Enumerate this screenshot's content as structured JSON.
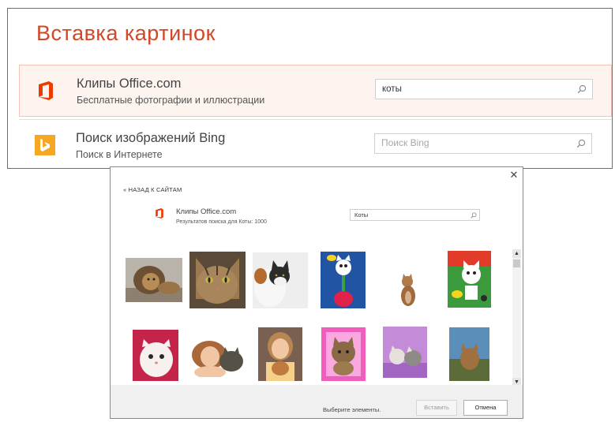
{
  "top_dialog": {
    "title": "Вставка картинок",
    "sources": [
      {
        "name": "Клипы Office.com",
        "description": "Бесплатные фотографии и иллюстрации",
        "search_value": "коты",
        "search_placeholder": "",
        "icon": "office-icon",
        "selected": true
      },
      {
        "name": "Поиск изображений Bing",
        "description": "Поиск в Интернете",
        "search_value": "",
        "search_placeholder": "Поиск Bing",
        "icon": "bing-icon",
        "selected": false
      }
    ]
  },
  "results_dialog": {
    "back_label": "« НАЗАД К САЙТАМ",
    "source_name": "Клипы Office.com",
    "result_count": "Результатов поиска для Коты: 1000",
    "search_value": "Коты",
    "close_icon": "close-icon",
    "thumbnails": [
      {
        "subject": "lion"
      },
      {
        "subject": "tabby-cat"
      },
      {
        "subject": "calico-cat"
      },
      {
        "subject": "cartoon-cat-blue"
      },
      {
        "subject": "kitten-small"
      },
      {
        "subject": "cartoon-cat-green"
      },
      {
        "subject": "white-persian-kitten"
      },
      {
        "subject": "girl-with-cat"
      },
      {
        "subject": "child-with-cat"
      },
      {
        "subject": "kitten-pink"
      },
      {
        "subject": "kittens-purple"
      },
      {
        "subject": "cat-outdoors"
      }
    ],
    "status_text": "Выберите элементы.",
    "insert_label": "Вставить",
    "cancel_label": "Отмена"
  },
  "colors": {
    "title_accent": "#d24726",
    "office_orange": "#eb3c00",
    "bing_orange": "#f5a623",
    "selected_bg": "#fdf3ef"
  }
}
